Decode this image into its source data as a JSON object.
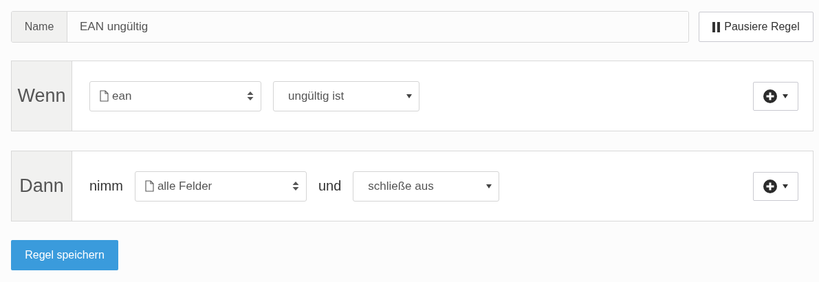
{
  "name": {
    "label": "Name",
    "value": "EAN ungültig"
  },
  "pause_button": {
    "label": "Pausiere Regel"
  },
  "blocks": [
    {
      "label": "Wenn",
      "items": [
        {
          "kind": "field",
          "value": "ean"
        },
        {
          "kind": "dropdown",
          "value": "ungültig ist"
        }
      ]
    },
    {
      "label": "Dann",
      "items": [
        {
          "kind": "text",
          "text": "nimm"
        },
        {
          "kind": "field",
          "value": "alle Felder"
        },
        {
          "kind": "text",
          "text": "und"
        },
        {
          "kind": "dropdown",
          "value": "schließe aus"
        }
      ]
    }
  ],
  "save_button": {
    "label": "Regel speichern"
  }
}
